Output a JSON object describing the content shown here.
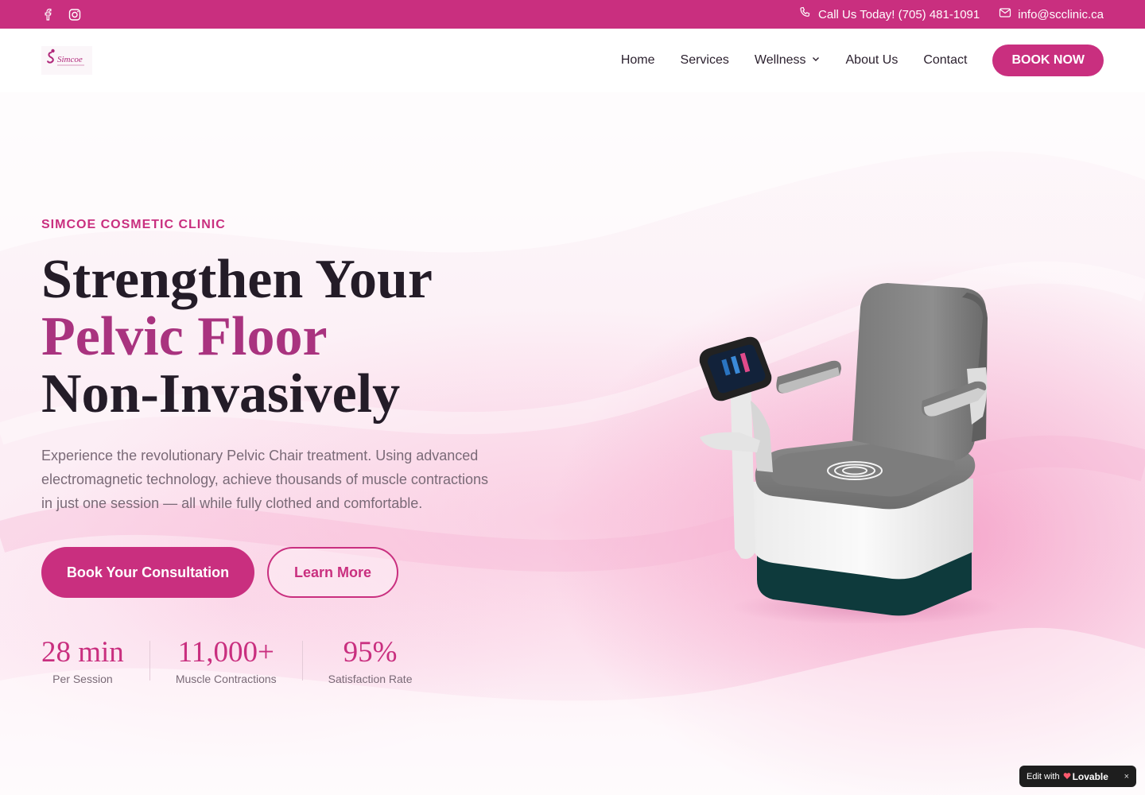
{
  "topbar": {
    "social_icons": [
      "facebook-icon",
      "instagram-icon"
    ],
    "phone_label": "Call Us Today! (705) 481-1091",
    "email_label": "info@scclinic.ca"
  },
  "header": {
    "logo_text": "Simcoe",
    "nav": [
      {
        "label": "Home"
      },
      {
        "label": "Services"
      },
      {
        "label": "Wellness"
      },
      {
        "label": "About Us"
      },
      {
        "label": "Contact"
      }
    ],
    "book_label": "BOOK NOW"
  },
  "hero": {
    "eyebrow": "SIMCOE COSMETIC CLINIC",
    "headline_line1": "Strengthen Your",
    "headline_line2": "Pelvic Floor",
    "headline_line3": "Non-Invasively",
    "lead": "Experience the revolutionary Pelvic Chair treatment. Using advanced electromagnetic technology, achieve thousands of muscle contractions in just one session — all while fully clothed and comfortable.",
    "primary_cta": "Book Your Consultation",
    "secondary_cta": "Learn More",
    "stats": [
      {
        "value": "28 min",
        "label": "Per Session"
      },
      {
        "value": "11,000+",
        "label": "Muscle Contractions"
      },
      {
        "value": "95%",
        "label": "Satisfaction Rate"
      }
    ]
  },
  "badge": {
    "prefix": "Edit with",
    "brand": "Lovable",
    "close": "×"
  },
  "colors": {
    "brand": "#c92f7f",
    "accent_headline": "#a9337f",
    "text_dark": "#241c28",
    "text_muted": "#7a6a77"
  }
}
